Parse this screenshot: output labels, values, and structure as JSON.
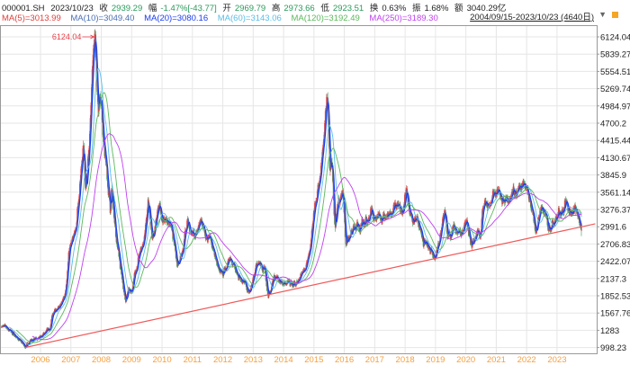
{
  "header": {
    "code": "000001.SH",
    "date": "2023/10/23",
    "close_label": "收",
    "close": "2939.29",
    "change_label": "幅",
    "change": "-1.47%[-43.77]",
    "open_label": "开",
    "open": "2969.79",
    "high_label": "高",
    "high": "2973.66",
    "low_label": "低",
    "low": "2923.51",
    "turnover_label": "换",
    "turnover": "0.63%",
    "amplitude_label": "振",
    "amplitude": "1.68%",
    "amount_label": "额",
    "amount": "3040.29亿"
  },
  "range_selector": {
    "label": "2004/09/15-2023/10/23 (4640日)",
    "icon": "triangle-down-icon"
  },
  "colors": {
    "up": "#e8414a",
    "down": "#2aa05a",
    "grid": "#e6e6e6",
    "trendline": "#f05a5a",
    "xaxis_text": "#f5a040"
  },
  "chart_data": {
    "type": "candlestick-line",
    "legend": [
      {
        "name": "MA(5)=3013.99",
        "period": 5,
        "color": "#e0403c"
      },
      {
        "name": "MA(10)=3049.40",
        "period": 10,
        "color": "#4a6fb5"
      },
      {
        "name": "MA(20)=3080.16",
        "period": 20,
        "color": "#1a3cf0"
      },
      {
        "name": "MA(60)=3143.06",
        "period": 60,
        "color": "#5bbde6"
      },
      {
        "name": "MA(120)=3192.49",
        "period": 120,
        "color": "#5cb85c"
      },
      {
        "name": "MA(250)=3189.30",
        "period": 250,
        "color": "#c040f0"
      }
    ],
    "yticks": [
      "6124.04",
      "5839.27",
      "5554.51",
      "5269.74",
      "4984.97",
      "4700.2",
      "4415.44",
      "4130.67",
      "3845.9",
      "3561.14",
      "3276.37",
      "2991.6",
      "2706.83",
      "2422.07",
      "2137.3",
      "1852.53",
      "1567.76",
      "1283",
      "998.23"
    ],
    "ylim": [
      998.23,
      6124.04
    ],
    "xticks": [
      "2006",
      "2007",
      "2008",
      "2009",
      "2010",
      "2011",
      "2012",
      "2013",
      "2014",
      "2015",
      "2016",
      "2017",
      "2018",
      "2019",
      "2020",
      "2021",
      "2022",
      "2023"
    ],
    "xlim": [
      "2004/09/15",
      "2023/10/23"
    ],
    "grid": true,
    "annotation": {
      "label": "6124.04",
      "date": 2007.79,
      "value": 6124.04
    },
    "trendline": {
      "start": [
        2005.5,
        1000
      ],
      "end": [
        2024.26,
        3040
      ]
    },
    "close_keypoints": [
      [
        2004.71,
        1350
      ],
      [
        2004.9,
        1320
      ],
      [
        2005.05,
        1250
      ],
      [
        2005.2,
        1180
      ],
      [
        2005.4,
        1060
      ],
      [
        2005.5,
        1000
      ],
      [
        2005.7,
        1150
      ],
      [
        2005.9,
        1100
      ],
      [
        2006.0,
        1180
      ],
      [
        2006.3,
        1300
      ],
      [
        2006.45,
        1650
      ],
      [
        2006.6,
        1600
      ],
      [
        2006.8,
        1850
      ],
      [
        2006.95,
        2600
      ],
      [
        2007.1,
        2800
      ],
      [
        2007.2,
        3100
      ],
      [
        2007.35,
        4000
      ],
      [
        2007.42,
        4300
      ],
      [
        2007.48,
        3600
      ],
      [
        2007.55,
        3900
      ],
      [
        2007.65,
        4900
      ],
      [
        2007.79,
        6124
      ],
      [
        2007.9,
        5000
      ],
      [
        2007.98,
        5300
      ],
      [
        2008.1,
        4300
      ],
      [
        2008.2,
        3800
      ],
      [
        2008.3,
        3300
      ],
      [
        2008.35,
        3600
      ],
      [
        2008.5,
        2800
      ],
      [
        2008.65,
        2300
      ],
      [
        2008.8,
        1700
      ],
      [
        2008.9,
        2000
      ],
      [
        2009.0,
        1900
      ],
      [
        2009.2,
        2400
      ],
      [
        2009.4,
        2750
      ],
      [
        2009.55,
        3400
      ],
      [
        2009.67,
        2750
      ],
      [
        2009.9,
        3300
      ],
      [
        2010.05,
        3100
      ],
      [
        2010.25,
        3100
      ],
      [
        2010.5,
        2400
      ],
      [
        2010.7,
        2650
      ],
      [
        2010.85,
        3150
      ],
      [
        2011.0,
        2800
      ],
      [
        2011.3,
        3050
      ],
      [
        2011.5,
        2700
      ],
      [
        2011.6,
        2800
      ],
      [
        2011.8,
        2350
      ],
      [
        2012.0,
        2200
      ],
      [
        2012.2,
        2450
      ],
      [
        2012.5,
        2200
      ],
      [
        2012.7,
        2050
      ],
      [
        2012.92,
        1960
      ],
      [
        2013.1,
        2400
      ],
      [
        2013.4,
        2250
      ],
      [
        2013.5,
        1850
      ],
      [
        2013.7,
        2200
      ],
      [
        2013.9,
        2100
      ],
      [
        2014.3,
        2000
      ],
      [
        2014.5,
        2050
      ],
      [
        2014.7,
        2300
      ],
      [
        2014.9,
        2700
      ],
      [
        2015.0,
        3300
      ],
      [
        2015.25,
        4000
      ],
      [
        2015.45,
        5178
      ],
      [
        2015.53,
        3800
      ],
      [
        2015.6,
        4000
      ],
      [
        2015.7,
        2950
      ],
      [
        2015.8,
        3400
      ],
      [
        2015.95,
        3600
      ],
      [
        2016.05,
        2700
      ],
      [
        2016.3,
        3000
      ],
      [
        2016.6,
        3000
      ],
      [
        2016.9,
        3250
      ],
      [
        2017.0,
        3100
      ],
      [
        2017.3,
        3250
      ],
      [
        2017.4,
        3100
      ],
      [
        2017.7,
        3380
      ],
      [
        2017.9,
        3300
      ],
      [
        2018.05,
        3560
      ],
      [
        2018.15,
        3150
      ],
      [
        2018.4,
        3100
      ],
      [
        2018.6,
        2750
      ],
      [
        2018.8,
        2600
      ],
      [
        2019.0,
        2450
      ],
      [
        2019.3,
        3250
      ],
      [
        2019.4,
        2850
      ],
      [
        2019.7,
        2950
      ],
      [
        2019.9,
        2900
      ],
      [
        2020.0,
        3100
      ],
      [
        2020.2,
        2700
      ],
      [
        2020.5,
        2950
      ],
      [
        2020.55,
        3400
      ],
      [
        2020.8,
        3300
      ],
      [
        2021.1,
        3650
      ],
      [
        2021.2,
        3400
      ],
      [
        2021.5,
        3600
      ],
      [
        2021.7,
        3550
      ],
      [
        2021.95,
        3650
      ],
      [
        2022.1,
        3450
      ],
      [
        2022.3,
        2900
      ],
      [
        2022.5,
        3350
      ],
      [
        2022.8,
        2900
      ],
      [
        2023.0,
        3150
      ],
      [
        2023.3,
        3350
      ],
      [
        2023.5,
        3200
      ],
      [
        2023.6,
        3300
      ],
      [
        2023.75,
        3100
      ],
      [
        2023.81,
        2939.29
      ]
    ]
  }
}
